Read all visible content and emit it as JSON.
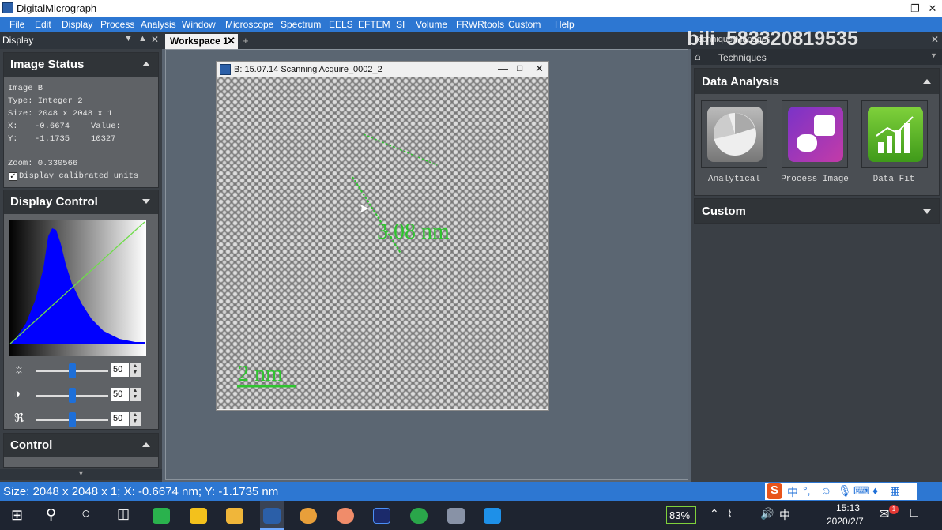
{
  "app": {
    "title": "DigitalMicrograph"
  },
  "menu": [
    "File",
    "Edit",
    "Display",
    "Process",
    "Analysis",
    "Window",
    "Microscope",
    "Spectrum",
    "EELS",
    "EFTEM",
    "SI",
    "Volume",
    "FRWRtools",
    "Custom",
    "Help"
  ],
  "left_panel": {
    "tab_label": "Display",
    "image_status": {
      "title": "Image Status",
      "image_name": "Image B",
      "type": "Type: Integer 2",
      "size": "Size: 2048 x 2048 x 1",
      "x_label": "X:",
      "x_value": "-0.6674",
      "value_label": "Value:",
      "y_label": "Y:",
      "y_value": "-1.1735",
      "value": "10327",
      "zoom": "Zoom: 0.330566",
      "calibrated_label": "Display calibrated units"
    },
    "display_control": {
      "title": "Display Control",
      "brightness": "50",
      "contrast": "50",
      "gamma": "50"
    },
    "control": {
      "title": "Control"
    }
  },
  "workspace": {
    "tab_label": "Workspace 1",
    "image_window_title": "B: 15.07.14 Scanning Acquire_0002_2",
    "measurement_label": "3.08 nm",
    "scale_bar_label": "2 nm"
  },
  "right_panel": {
    "title": "Technique Manager",
    "techniques_label": "Techniques",
    "data_analysis_title": "Data Analysis",
    "tiles": [
      "Analytical",
      "Process Image",
      "Data Fit"
    ],
    "custom_title": "Custom",
    "watermark": "bili_583320819535"
  },
  "status_bar": {
    "text": "Size: 2048 x 2048 x 1;  X:  -0.6674 nm;  Y:  -1.1735 nm"
  },
  "taskbar": {
    "battery": "83%",
    "time": "15:13",
    "date": "2020/2/7",
    "ime": "中",
    "notification_count": "1"
  },
  "colors": {
    "menubar": "#2d77d2",
    "panel": "#3a3f45",
    "histogram": "#0000ff"
  }
}
